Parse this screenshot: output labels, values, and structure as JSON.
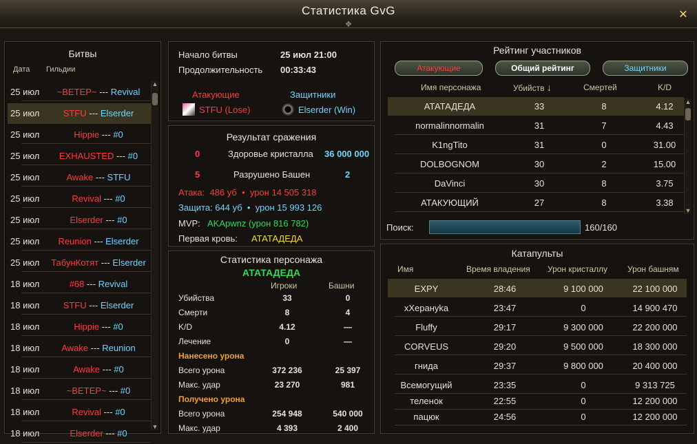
{
  "window": {
    "title": "Статистика GvG",
    "close_icon": "close-icon"
  },
  "battles": {
    "header": "Битвы",
    "col_date": "Дата",
    "col_guilds": "Гильдии",
    "rows": [
      {
        "date": "25 июл",
        "attacker": "~ВЕТЕР~",
        "sep": "---",
        "defender": "Revival"
      },
      {
        "date": "25 июл",
        "attacker": "STFU",
        "sep": "---",
        "defender": "Elserder"
      },
      {
        "date": "25 июл",
        "attacker": "Hippie",
        "sep": "---",
        "defender": "#0"
      },
      {
        "date": "25 июл",
        "attacker": "EXHAUSTED",
        "sep": "---",
        "defender": "#0"
      },
      {
        "date": "25 июл",
        "attacker": "Awake",
        "sep": "---",
        "defender": "STFU"
      },
      {
        "date": "25 июл",
        "attacker": "Revival",
        "sep": "---",
        "defender": "#0"
      },
      {
        "date": "25 июл",
        "attacker": "Elserder",
        "sep": "---",
        "defender": "#0"
      },
      {
        "date": "25 июл",
        "attacker": "Reunion",
        "sep": "---",
        "defender": "Elserder"
      },
      {
        "date": "25 июл",
        "attacker": "ТабунКотят",
        "sep": "---",
        "defender": "Elserder"
      },
      {
        "date": "18 июл",
        "attacker": "#68",
        "sep": "---",
        "defender": "Revival"
      },
      {
        "date": "18 июл",
        "attacker": "STFU",
        "sep": "---",
        "defender": "Elserder"
      },
      {
        "date": "18 июл",
        "attacker": "Hippie",
        "sep": "---",
        "defender": "#0"
      },
      {
        "date": "18 июл",
        "attacker": "Awake",
        "sep": "---",
        "defender": "Reunion"
      },
      {
        "date": "18 июл",
        "attacker": "Awake",
        "sep": "---",
        "defender": "#0"
      },
      {
        "date": "18 июл",
        "attacker": "~ВЕТЕР~",
        "sep": "---",
        "defender": "#0"
      },
      {
        "date": "18 июл",
        "attacker": "Revival",
        "sep": "---",
        "defender": "#0"
      },
      {
        "date": "18 июл",
        "attacker": "Elserder",
        "sep": "---",
        "defender": "#0"
      }
    ]
  },
  "info": {
    "start_label": "Начало битвы",
    "start_value": "25 июл 21:00",
    "duration_label": "Продолжительность",
    "duration_value": "00:33:43",
    "attackers_label": "Атакующие",
    "defenders_label": "Защитники",
    "attacker_guild": "STFU (Lose)",
    "defender_guild": "Elserder (Win)"
  },
  "result": {
    "header": "Результат сражения",
    "crystal_left": "0",
    "crystal_label": "Здоровье кристалла",
    "crystal_value": "36 000 000",
    "towers_left": "5",
    "towers_label": "Разрушено Башен",
    "towers_right": "2",
    "attack_line": "Атака:  486 уб  •  урон 14 505 318",
    "defense_line": "Защита: 644 уб  •  урон 15 993 126",
    "mvp_label": "MVP:",
    "mvp_value": "AKApwnz (урон 816 782)",
    "first_blood_label": "Первая кровь:",
    "first_blood_value": "АТАТАДЕДА"
  },
  "char_stats": {
    "header": "Статистика персонажа",
    "name": "АТАТАДЕДА",
    "col_players": "Игроки",
    "col_towers": "Башни",
    "rows": [
      {
        "label": "Убийства",
        "players": "33",
        "towers": "0",
        "type": "row"
      },
      {
        "label": "Смерти",
        "players": "8",
        "towers": "4",
        "type": "row"
      },
      {
        "label": "K/D",
        "players": "4.12",
        "towers": "—",
        "type": "row"
      },
      {
        "label": "Лечение",
        "players": "0",
        "towers": "—",
        "type": "row"
      },
      {
        "label": "Нанесено урона",
        "players": "",
        "towers": "",
        "type": "section"
      },
      {
        "label": "Всего урона",
        "players": "372 236",
        "towers": "25 397",
        "type": "row"
      },
      {
        "label": "Макс. удар",
        "players": "23 270",
        "towers": "981",
        "type": "row"
      },
      {
        "label": "Получено урона",
        "players": "",
        "towers": "",
        "type": "section"
      },
      {
        "label": "Всего урона",
        "players": "254 948",
        "towers": "540 000",
        "type": "row"
      },
      {
        "label": "Макс. удар",
        "players": "4 393",
        "towers": "2 400",
        "type": "row"
      }
    ]
  },
  "rating": {
    "header": "Рейтинг участников",
    "tab_attackers": "Атакующие",
    "tab_overall": "Общий рейтинг",
    "tab_defenders": "Защитники",
    "col_name": "Имя персонажа",
    "col_kills": "Убийств",
    "sort_icon": "↓",
    "col_deaths": "Смертей",
    "col_kd": "K/D",
    "rows": [
      {
        "name": "АТАТАДЕДА",
        "kills": "33",
        "deaths": "8",
        "kd": "4.12"
      },
      {
        "name": "normalinnormalin",
        "kills": "31",
        "deaths": "7",
        "kd": "4.43"
      },
      {
        "name": "K1ngTito",
        "kills": "31",
        "deaths": "0",
        "kd": "31.00"
      },
      {
        "name": "DOLBOGNOM",
        "kills": "30",
        "deaths": "2",
        "kd": "15.00"
      },
      {
        "name": "DaVinci",
        "kills": "30",
        "deaths": "8",
        "kd": "3.75"
      },
      {
        "name": "АТАКУЮЩИЙ",
        "kills": "27",
        "deaths": "8",
        "kd": "3.38"
      }
    ],
    "search_label": "Поиск:",
    "search_value": "",
    "count": "160/160"
  },
  "catapults": {
    "header": "Катапульты",
    "col_name": "Имя",
    "col_time": "Время владения",
    "col_crystal": "Урон кристаллу",
    "col_towers": "Урон башням",
    "rows": [
      {
        "name": "EXPY",
        "time": "28:46",
        "crystal": "9 100 000",
        "towers": "22 100 000"
      },
      {
        "name": "хХерануkа",
        "time": "23:47",
        "crystal": "0",
        "towers": "14 900 470"
      },
      {
        "name": "Fluffy",
        "time": "29:17",
        "crystal": "9 300 000",
        "towers": "22 200 000"
      },
      {
        "name": "CORVEUS",
        "time": "29:20",
        "crystal": "9 500 000",
        "towers": "18 300 000"
      },
      {
        "name": "гнида",
        "time": "29:37",
        "crystal": "9 800 000",
        "towers": "20 400 000"
      },
      {
        "name": "Всемогущий",
        "time": "23:35",
        "crystal": "0",
        "towers": "9 313 725"
      },
      {
        "name": "теленок",
        "time": "22:55",
        "crystal": "0",
        "towers": "12 200 000"
      },
      {
        "name": "пацюк",
        "time": "24:56",
        "crystal": "0",
        "towers": "12 200 000"
      }
    ]
  },
  "colors": {
    "attacker": "#ff3b3b",
    "defender": "#6fd6ff",
    "highlight": "#3a3520"
  }
}
